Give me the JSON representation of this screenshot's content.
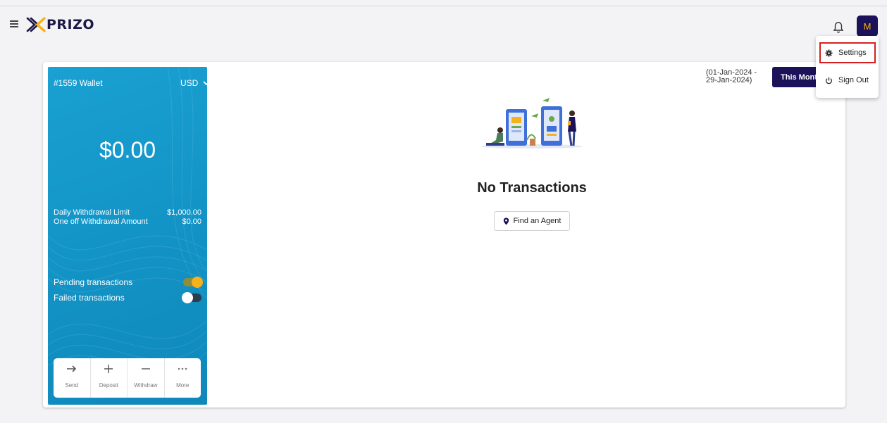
{
  "header": {
    "brand": "PRIZO",
    "avatar_initial": "M"
  },
  "wallet": {
    "name": "#1559 Wallet",
    "currency": "USD",
    "balance": "$0.00",
    "limits": [
      {
        "label": "Daily Withdrawal Limit",
        "value": "$1,000.00"
      },
      {
        "label": "One off Withdrawal Amount",
        "value": "$0.00"
      }
    ],
    "toggles": [
      {
        "label": "Pending transactions",
        "on": true
      },
      {
        "label": "Failed transactions",
        "on": false
      }
    ],
    "actions": [
      {
        "label": "Send",
        "icon": "arrow-right-icon"
      },
      {
        "label": "Deposit",
        "icon": "plus-icon"
      },
      {
        "label": "Withdraw",
        "icon": "minus-icon"
      },
      {
        "label": "More",
        "icon": "more-icon"
      }
    ]
  },
  "content": {
    "empty_title": "No Transactions",
    "find_agent_label": "Find an Agent",
    "date_range_line1": "(01-Jan-2024 -",
    "date_range_line2": "29-Jan-2024)",
    "period_button": "This Month"
  },
  "user_menu": {
    "items": [
      {
        "label": "Settings",
        "icon": "gear-icon",
        "highlighted": true
      },
      {
        "label": "Sign Out",
        "icon": "power-icon",
        "highlighted": false
      }
    ]
  },
  "colors": {
    "brand_navy": "#1c1259",
    "wallet_blue": "#1394c6",
    "accent_yellow": "#f5b21b",
    "highlight_red": "#d42020"
  }
}
